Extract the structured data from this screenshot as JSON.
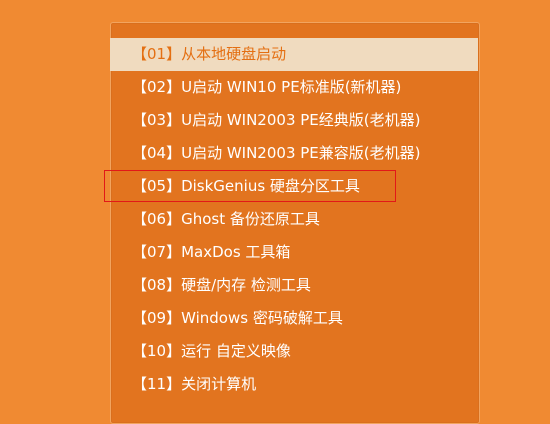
{
  "boot_menu": {
    "items": [
      "【01】从本地硬盘启动",
      "【02】U启动 WIN10 PE标准版(新机器)",
      "【03】U启动 WIN2003 PE经典版(老机器)",
      "【04】U启动 WIN2003 PE兼容版(老机器)",
      "【05】DiskGenius 硬盘分区工具",
      "【06】Ghost 备份还原工具",
      "【07】MaxDos 工具箱",
      "【08】硬盘/内存 检测工具",
      "【09】Windows 密码破解工具",
      "【10】运行 自定义映像",
      "【11】关闭计算机"
    ],
    "selected_index": 0,
    "highlighted_index": 4
  },
  "colors": {
    "background": "#f08a32",
    "panel": "#e2741f",
    "selected_bg": "#f0dbbf",
    "selected_text": "#e46f12",
    "highlight_border": "#e21818"
  }
}
